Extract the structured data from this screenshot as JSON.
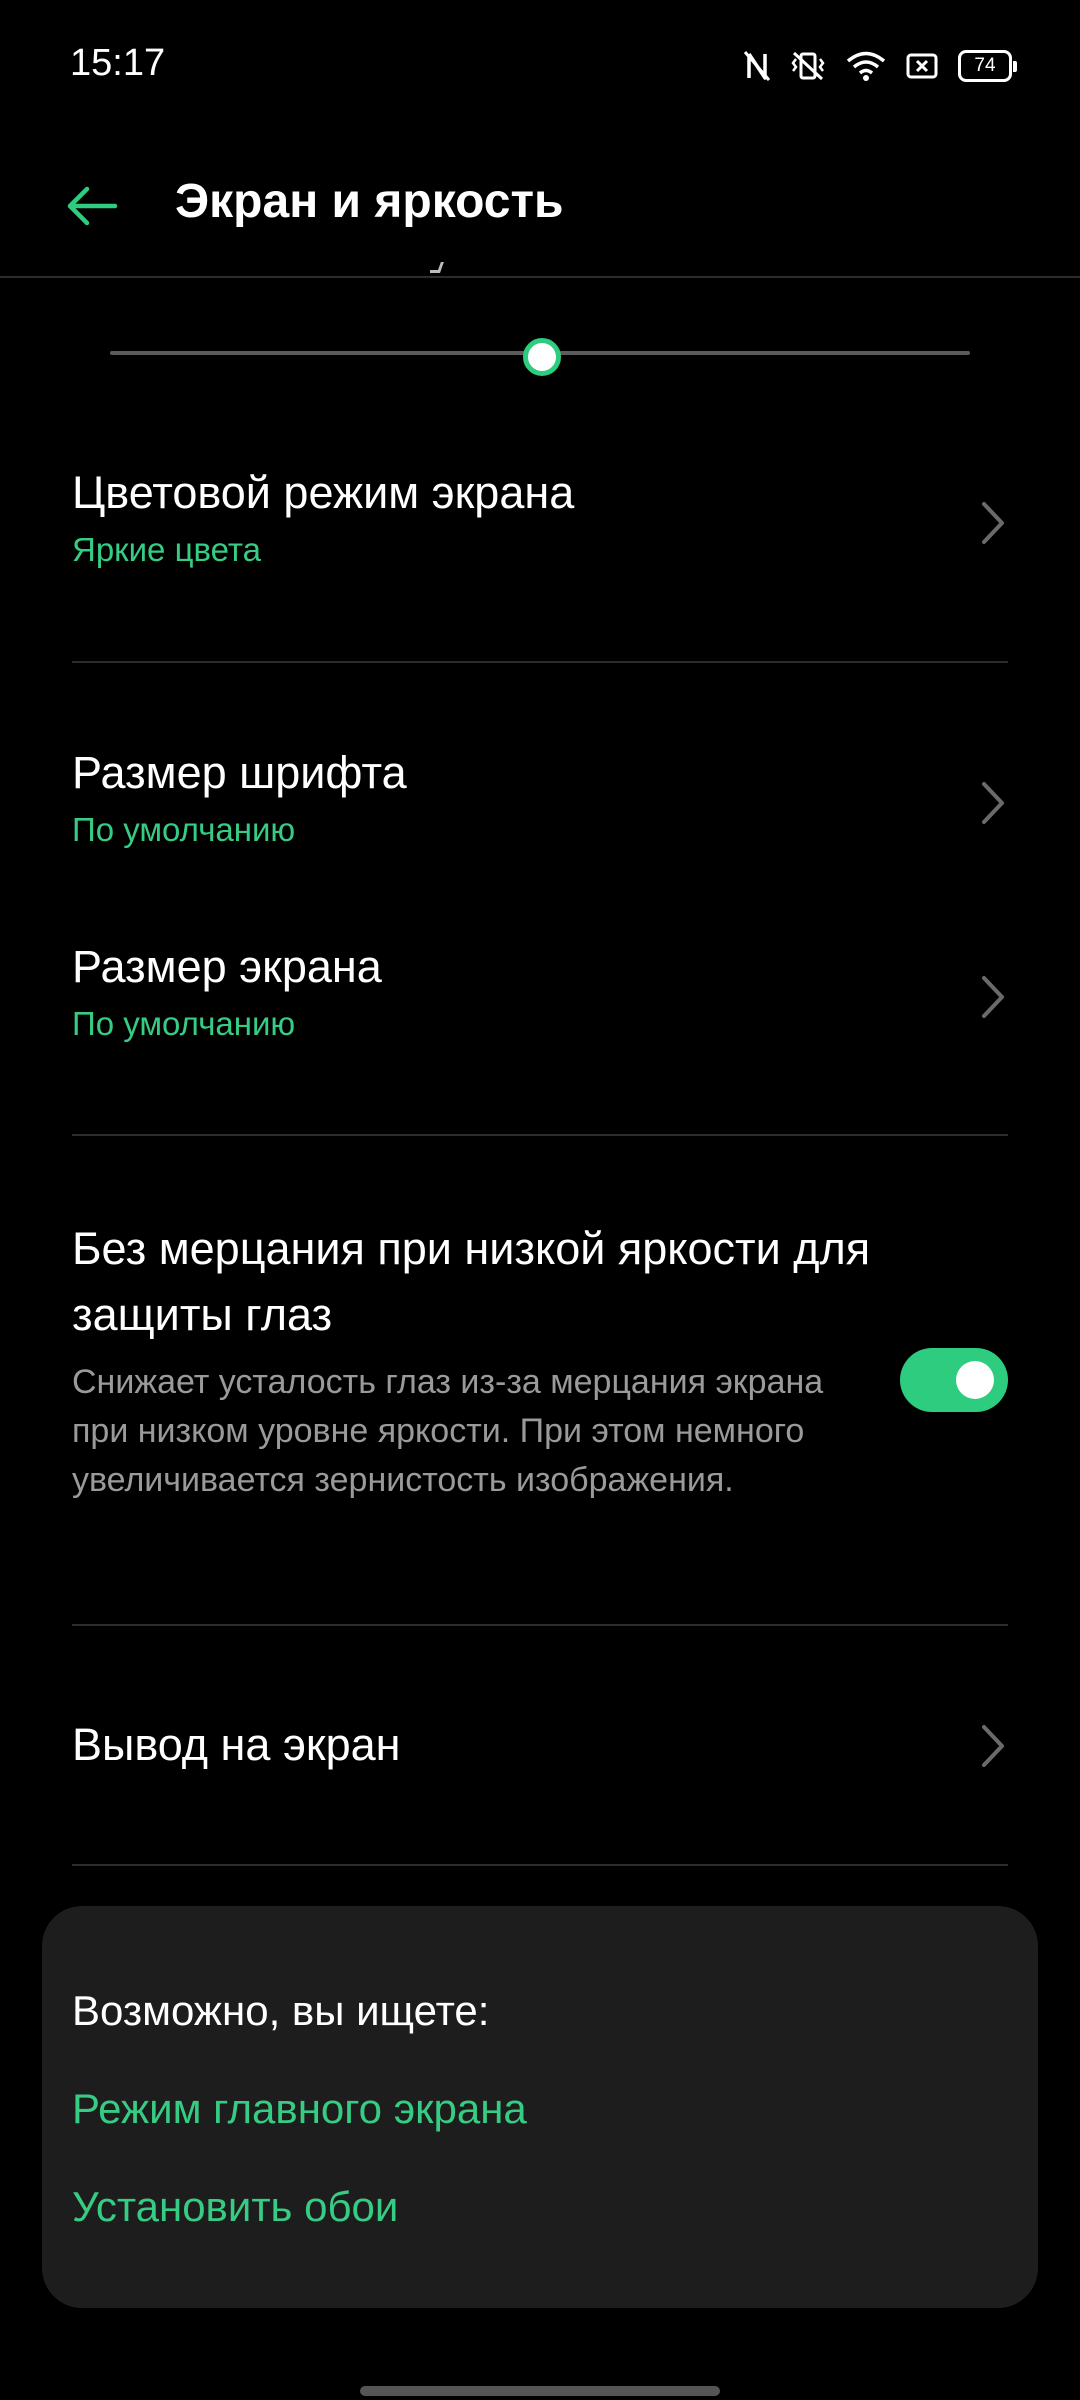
{
  "status_bar": {
    "time": "15:17",
    "battery": "74",
    "icons": [
      "nfc-off-icon",
      "vibrate-icon",
      "wifi-icon",
      "screen-record-icon",
      "battery-icon"
    ]
  },
  "header": {
    "back_icon": "arrow-left-icon",
    "title": "Экран и яркость"
  },
  "slider": {
    "value": 0.5
  },
  "settings": {
    "color_mode": {
      "title": "Цветовой режим экрана",
      "value": "Яркие цвета"
    },
    "font_size": {
      "title": "Размер шрифта",
      "value": "По умолчанию"
    },
    "screen_size": {
      "title": "Размер экрана",
      "value": "По умолчанию"
    },
    "flicker_free": {
      "title": "Без мерцания при низкой яркости для защиты глаз",
      "description": "Снижает усталость глаз из-за мерцания экрана при низком уровне яркости. При этом немного увеличивается зернистость изображения.",
      "enabled": true
    },
    "screen_output": {
      "title": "Вывод на экран"
    }
  },
  "suggestions": {
    "title": "Возможно, вы ищете:",
    "links": [
      "Режим главного экрана",
      "Установить обои"
    ]
  },
  "colors": {
    "accent": "#2ecc7e",
    "background": "#000000",
    "card": "#1d1d1d",
    "divider": "#2c2c2c",
    "secondary_text": "#9a9a9a"
  }
}
